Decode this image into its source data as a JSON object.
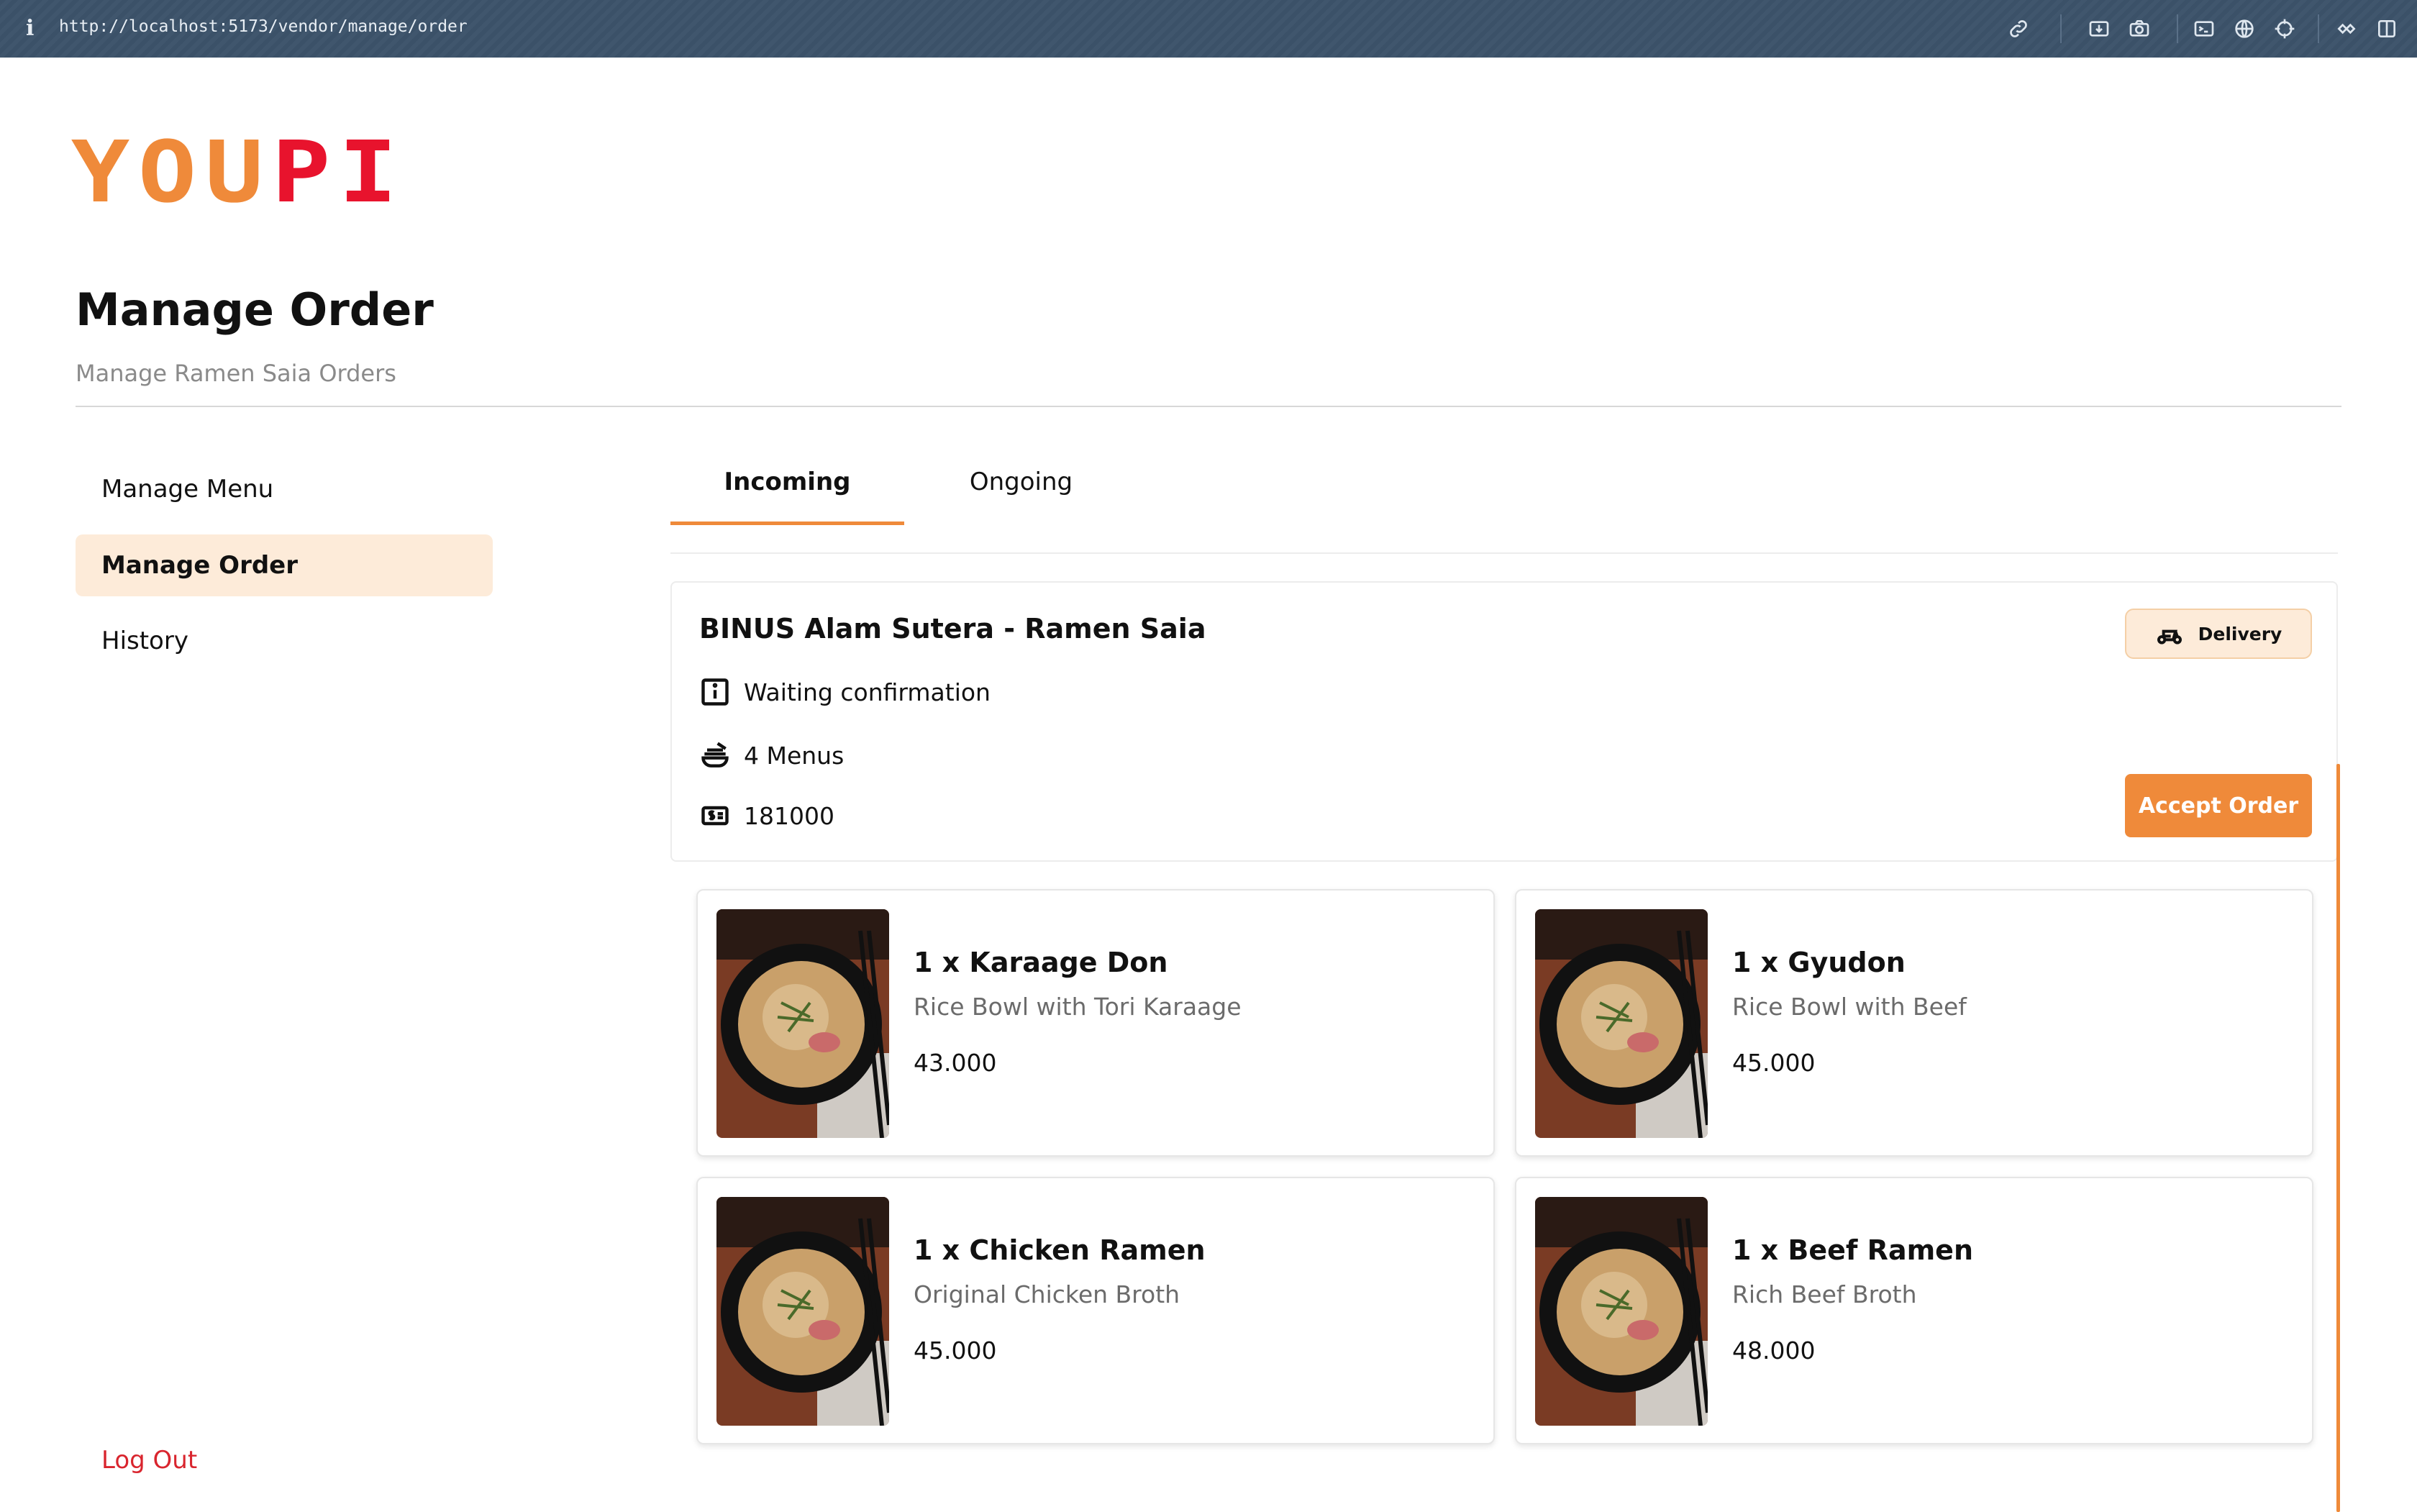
{
  "browser": {
    "url": "http://localhost:5173/vendor/manage/order",
    "info_glyph": "i"
  },
  "logo": {
    "letters": [
      "Y",
      "O",
      "U",
      "P",
      "I"
    ]
  },
  "header": {
    "title": "Manage Order",
    "subtitle": "Manage Ramen Saia Orders"
  },
  "sidebar": {
    "items": [
      {
        "label": "Manage Menu",
        "active": false
      },
      {
        "label": "Manage Order",
        "active": true
      },
      {
        "label": "History",
        "active": false
      }
    ],
    "logout_label": "Log Out"
  },
  "tabs": [
    {
      "label": "Incoming",
      "active": true
    },
    {
      "label": "Ongoing",
      "active": false
    }
  ],
  "order": {
    "store": "BINUS Alam Sutera - Ramen Saia",
    "status": "Waiting confirmation",
    "menus_count": "4 Menus",
    "total": "181000",
    "delivery_label": "Delivery",
    "accept_label": "Accept Order",
    "items": [
      {
        "name": "1 x Karaage Don",
        "desc": "Rice Bowl with Tori Karaage",
        "price": "43.000"
      },
      {
        "name": "1 x Gyudon",
        "desc": "Rice Bowl with Beef",
        "price": "45.000"
      },
      {
        "name": "1 x Chicken Ramen",
        "desc": "Original Chicken Broth",
        "price": "45.000"
      },
      {
        "name": "1 x Beef Ramen",
        "desc": "Rich Beef Broth",
        "price": "48.000"
      }
    ]
  },
  "colors": {
    "accent": "#ef8a3a",
    "accent_soft": "#fdebd9",
    "logo_red": "#e8132d",
    "logout_red": "#d9252e",
    "browser_bar": "#3b5168"
  },
  "icons": {
    "info": "info-box-icon",
    "menus": "food-bowl-icon",
    "total": "money-icon",
    "delivery": "scooter-icon"
  }
}
